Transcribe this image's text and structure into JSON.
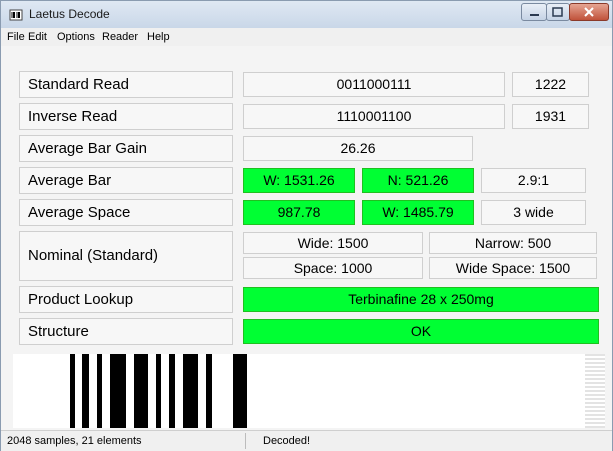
{
  "window": {
    "title": "Laetus Decode"
  },
  "menu": [
    "File",
    "Edit",
    "Options",
    "Reader",
    "Help"
  ],
  "rows": {
    "standard_read": {
      "label": "Standard Read",
      "value": "0011000111",
      "count": "1222"
    },
    "inverse_read": {
      "label": "Inverse Read",
      "value": "1110001100",
      "count": "1931"
    },
    "average_bar_gain": {
      "label": "Average Bar Gain",
      "value": "26.26"
    },
    "average_bar": {
      "label": "Average Bar",
      "wide": "W: 1531.26",
      "narrow": "N: 521.26",
      "ratio": "2.9:1"
    },
    "average_space": {
      "label": "Average Space",
      "narrow": "987.78",
      "wide": "W: 1485.79",
      "note": "3 wide"
    },
    "nominal": {
      "label": "Nominal (Standard)",
      "wide": "Wide: 1500",
      "narrow": "Narrow: 500",
      "space": "Space: 1000",
      "wide_space": "Wide Space: 1500"
    },
    "product_lookup": {
      "label": "Product Lookup",
      "value": "Terbinafine 28 x 250mg"
    },
    "structure": {
      "label": "Structure",
      "value": "OK"
    }
  },
  "status": {
    "left": "2048 samples, 21 elements",
    "right": "Decoded!"
  },
  "colors": {
    "highlight": "#00ff33",
    "titlebar": "#c9d7e8",
    "close_button": "#c0523a"
  }
}
